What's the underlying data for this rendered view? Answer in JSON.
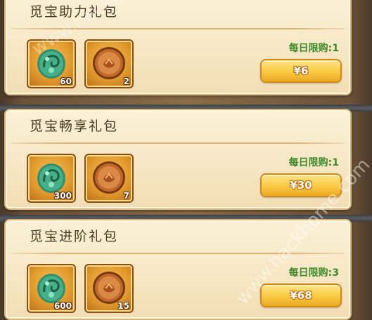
{
  "packs": [
    {
      "title": "觅宝助力礼包",
      "items": [
        {
          "icon": "jade-pendant-icon",
          "qty": "60"
        },
        {
          "icon": "copper-coin-icon",
          "qty": "2"
        }
      ],
      "limit": "每日限购:1",
      "price": "¥6"
    },
    {
      "title": "觅宝畅享礼包",
      "items": [
        {
          "icon": "jade-pendant-icon",
          "qty": "300"
        },
        {
          "icon": "copper-coin-icon",
          "qty": "7"
        }
      ],
      "limit": "每日限购:1",
      "price": "¥30"
    },
    {
      "title": "觅宝进阶礼包",
      "items": [
        {
          "icon": "jade-pendant-icon",
          "qty": "600"
        },
        {
          "icon": "copper-coin-icon",
          "qty": "15"
        }
      ],
      "limit": "每日限购:3",
      "price": "¥68"
    }
  ],
  "watermark": "www.hackhome.com",
  "colors": {
    "card_bg": "#f6e6c2",
    "limit_text": "#3c8a2a",
    "price_button": "#fbcd45",
    "item_frame": "#e29a2c"
  }
}
